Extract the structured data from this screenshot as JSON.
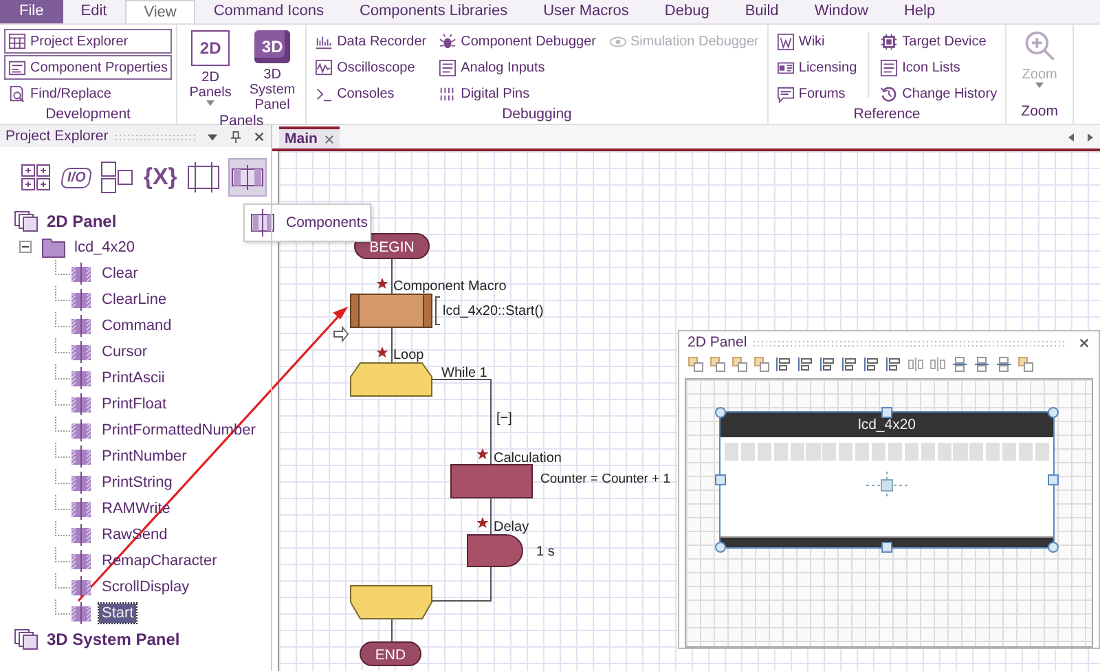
{
  "menu": [
    {
      "label": "File",
      "kind": "app",
      "selected": false
    },
    {
      "label": "Edit",
      "kind": "tab",
      "selected": false
    },
    {
      "label": "View",
      "kind": "tab",
      "selected": true
    },
    {
      "label": "Command Icons",
      "kind": "tab",
      "selected": false
    },
    {
      "label": "Components Libraries",
      "kind": "tab",
      "selected": false
    },
    {
      "label": "User Macros",
      "kind": "tab",
      "selected": false
    },
    {
      "label": "Debug",
      "kind": "tab",
      "selected": false
    },
    {
      "label": "Build",
      "kind": "tab",
      "selected": false
    },
    {
      "label": "Window",
      "kind": "tab",
      "selected": false
    },
    {
      "label": "Help",
      "kind": "tab",
      "selected": false
    }
  ],
  "ribbon": {
    "groups": [
      {
        "label": "Development",
        "kind": "small",
        "columns": [
          [
            {
              "label": "Project Explorer",
              "checked": true
            },
            {
              "label": "Component Properties",
              "checked": true
            },
            {
              "label": "Find/Replace",
              "checked": false
            }
          ]
        ]
      },
      {
        "label": "Panels",
        "kind": "large",
        "buttons": [
          {
            "label": "2D Panels",
            "icon_text": "2D",
            "dropdown": true,
            "disabled": false
          },
          {
            "label": "3D System Panel",
            "icon_text": "3D",
            "dropdown": false,
            "disabled": false
          }
        ]
      },
      {
        "label": "Debugging",
        "kind": "small",
        "columns": [
          [
            {
              "label": "Data Recorder",
              "disabled": false
            },
            {
              "label": "Oscilloscope",
              "disabled": false
            },
            {
              "label": "Consoles",
              "disabled": false
            }
          ],
          [
            {
              "label": "Component Debugger",
              "disabled": false
            },
            {
              "label": "Analog Inputs",
              "disabled": false
            },
            {
              "label": "Digital Pins",
              "disabled": false
            }
          ],
          [
            {
              "label": "Simulation Debugger",
              "disabled": true
            }
          ]
        ]
      },
      {
        "label": "Reference",
        "kind": "small",
        "columns": [
          [
            {
              "label": "Wiki",
              "disabled": false
            },
            {
              "label": "Licensing",
              "disabled": false
            },
            {
              "label": "Forums",
              "disabled": false
            }
          ],
          [
            {
              "label": "Target Device",
              "disabled": false
            },
            {
              "label": "Icon Lists",
              "disabled": false
            },
            {
              "label": "Change History",
              "disabled": false
            }
          ]
        ]
      },
      {
        "label": "Zoom",
        "kind": "large",
        "buttons": [
          {
            "label": "Zoom",
            "dropdown": true,
            "disabled": true
          }
        ]
      }
    ]
  },
  "project_explorer": {
    "title": "Project Explorer",
    "toolbar": [
      {
        "selected": false
      },
      {
        "label": "I/O",
        "selected": false
      },
      {
        "selected": false
      },
      {
        "label": "{X}",
        "selected": false
      },
      {
        "selected": false
      },
      {
        "selected": true
      }
    ],
    "tree": [
      {
        "label": "2D Panel",
        "kind": "panel",
        "children": [
          {
            "label": "lcd_4x20",
            "kind": "component",
            "expanded": true,
            "children": [
              {
                "label": "Clear",
                "kind": "macro",
                "selected": false
              },
              {
                "label": "ClearLine",
                "kind": "macro",
                "selected": false
              },
              {
                "label": "Command",
                "kind": "macro",
                "selected": false
              },
              {
                "label": "Cursor",
                "kind": "macro",
                "selected": false
              },
              {
                "label": "PrintAscii",
                "kind": "macro",
                "selected": false
              },
              {
                "label": "PrintFloat",
                "kind": "macro",
                "selected": false
              },
              {
                "label": "PrintFormattedNumber",
                "kind": "macro",
                "selected": false
              },
              {
                "label": "PrintNumber",
                "kind": "macro",
                "selected": false
              },
              {
                "label": "PrintString",
                "kind": "macro",
                "selected": false
              },
              {
                "label": "RAMWrite",
                "kind": "macro",
                "selected": false
              },
              {
                "label": "RawSend",
                "kind": "macro",
                "selected": false
              },
              {
                "label": "RemapCharacter",
                "kind": "macro",
                "selected": false
              },
              {
                "label": "ScrollDisplay",
                "kind": "macro",
                "selected": false
              },
              {
                "label": "Start",
                "kind": "macro",
                "selected": true
              }
            ]
          }
        ]
      },
      {
        "label": "3D System Panel",
        "kind": "panel"
      }
    ]
  },
  "tooltip": {
    "label": "Components"
  },
  "editor": {
    "tabs": [
      {
        "label": "Main",
        "selected": true
      }
    ],
    "flowchart": {
      "nodes": [
        {
          "kind": "terminator",
          "text": "BEGIN"
        },
        {
          "kind": "macro",
          "label": "Component Macro",
          "detail": "lcd_4x20::Start()"
        },
        {
          "kind": "loop",
          "label": "Loop",
          "detail": "While 1",
          "toggle": "[−]"
        },
        {
          "kind": "calculation",
          "label": "Calculation",
          "detail": "Counter = Counter + 1"
        },
        {
          "kind": "delay",
          "label": "Delay",
          "detail": "1 s"
        },
        {
          "kind": "loop_end"
        },
        {
          "kind": "terminator",
          "text": "END"
        }
      ]
    }
  },
  "panel_2d": {
    "title": "2D Panel",
    "component": {
      "title": "lcd_4x20"
    }
  }
}
